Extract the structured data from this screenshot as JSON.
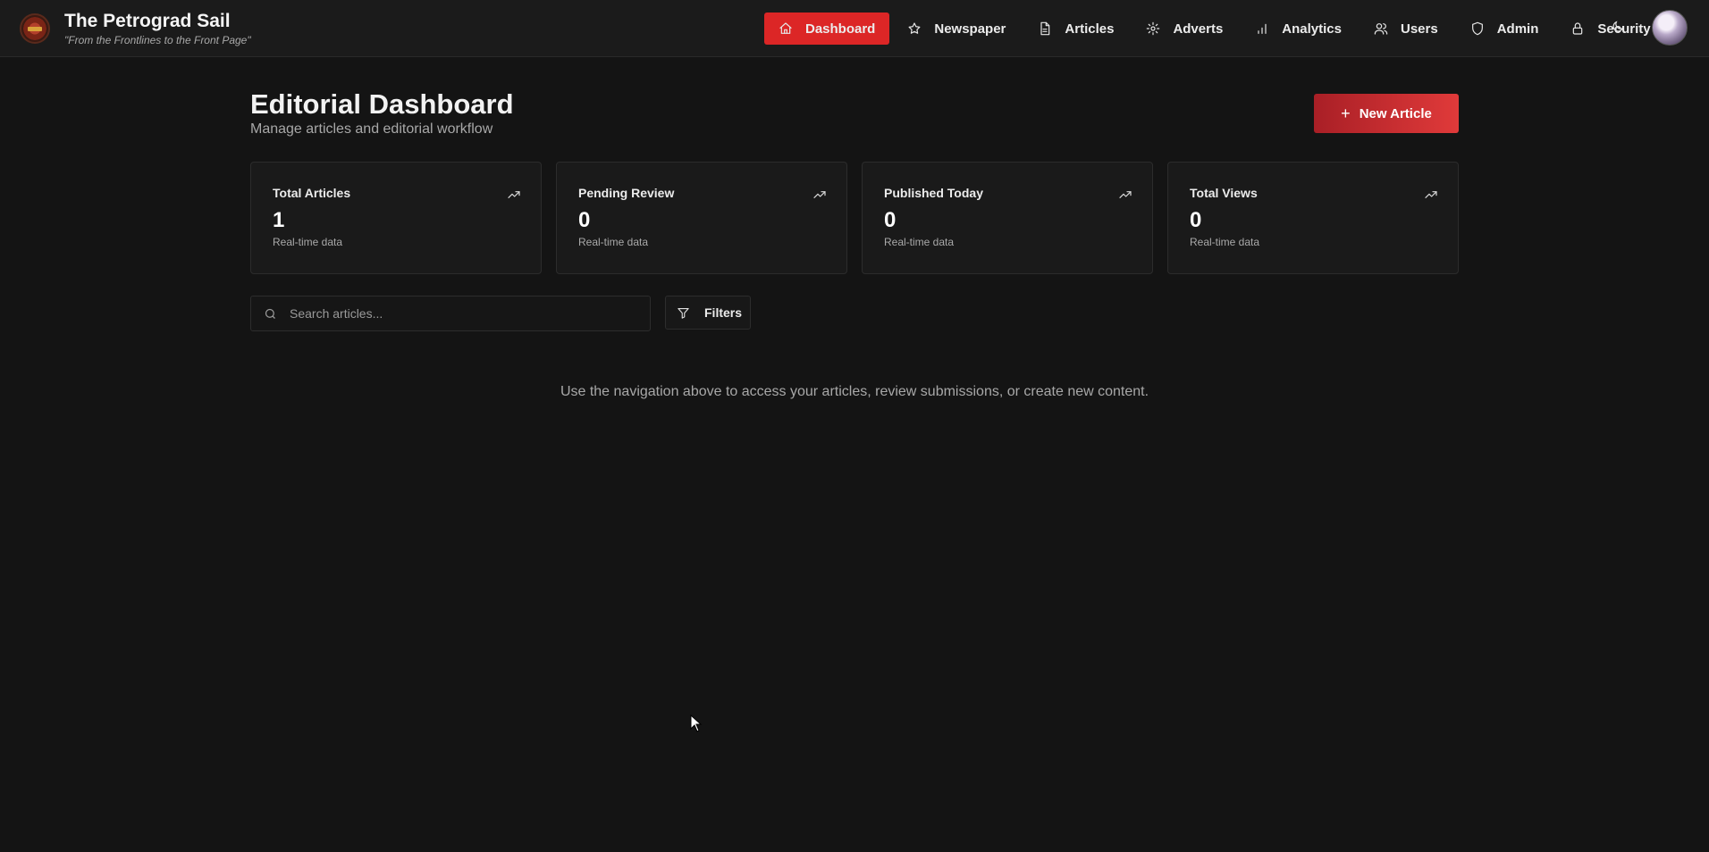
{
  "brand": {
    "title": "The Petrograd Sail",
    "tagline": "\"From the Frontlines to the Front Page\""
  },
  "nav": {
    "items": [
      {
        "label": "Dashboard",
        "icon": "home-icon",
        "active": true
      },
      {
        "label": "Newspaper",
        "icon": "star-icon"
      },
      {
        "label": "Articles",
        "icon": "document-icon"
      },
      {
        "label": "Adverts",
        "icon": "gear-icon"
      },
      {
        "label": "Analytics",
        "icon": "bar-chart-icon"
      },
      {
        "label": "Users",
        "icon": "users-icon"
      },
      {
        "label": "Admin",
        "icon": "shield-icon"
      },
      {
        "label": "Security",
        "icon": "lock-icon"
      }
    ],
    "theme_icon": "moon-icon",
    "accent": "#dc2626"
  },
  "page": {
    "title": "Editorial Dashboard",
    "subtitle": "Manage articles and editorial workflow",
    "new_button": "New Article"
  },
  "stats": [
    {
      "title": "Total Articles",
      "value": "1",
      "note": "Real-time data"
    },
    {
      "title": "Pending Review",
      "value": "0",
      "note": "Real-time data"
    },
    {
      "title": "Published Today",
      "value": "0",
      "note": "Real-time data"
    },
    {
      "title": "Total Views",
      "value": "0",
      "note": "Real-time data"
    }
  ],
  "search": {
    "placeholder": "Search articles...",
    "value": ""
  },
  "filters": {
    "label": "Filters"
  },
  "hint": "Use the navigation above to access your articles, review submissions, or create new content."
}
